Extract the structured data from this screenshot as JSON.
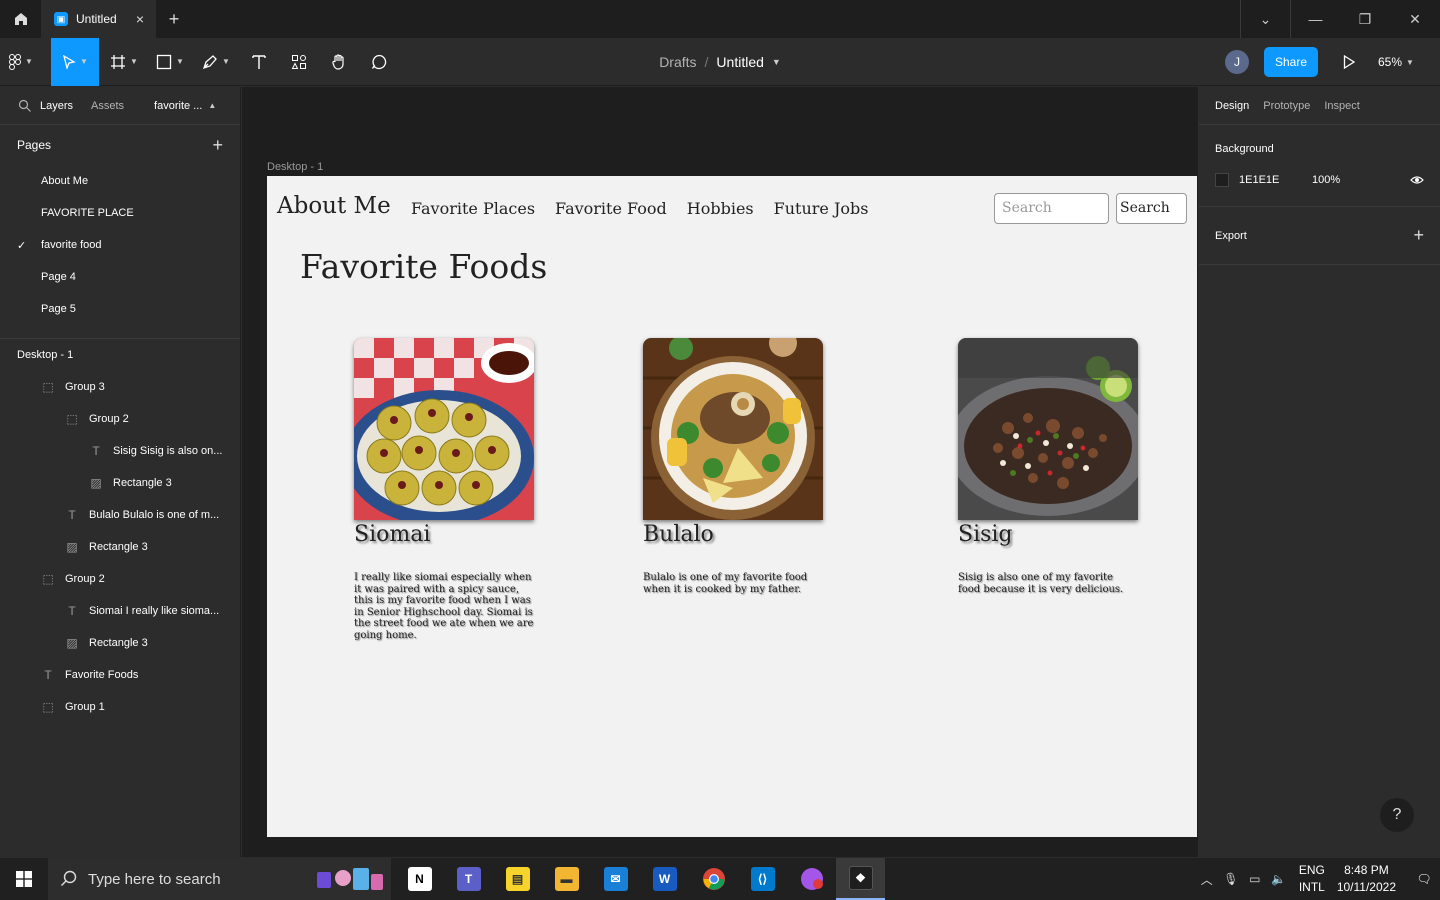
{
  "window": {
    "tab_title": "Untitled",
    "tab_close": "×",
    "new_tab": "+",
    "controls": [
      "chevron-down",
      "minimize",
      "restore",
      "close"
    ]
  },
  "toolbar": {
    "breadcrumb_root": "Drafts",
    "breadcrumb_separator": "/",
    "file_name": "Untitled",
    "avatar_initial": "J",
    "share_label": "Share",
    "zoom": "65%"
  },
  "left_panel": {
    "tabs": [
      "Layers",
      "Assets"
    ],
    "current_page_short": "favorite ...",
    "pages_header": "Pages",
    "pages": [
      {
        "label": "About Me",
        "selected": false
      },
      {
        "label": "FAVORITE PLACE",
        "selected": false
      },
      {
        "label": "favorite food",
        "selected": true
      },
      {
        "label": "Page 4",
        "selected": false
      },
      {
        "label": "Page 5",
        "selected": false
      }
    ],
    "layers": [
      {
        "label": "Desktop - 1",
        "type": "frame",
        "depth": 0
      },
      {
        "label": "Group 3",
        "type": "group",
        "depth": 1
      },
      {
        "label": "Group 2",
        "type": "group",
        "depth": 2
      },
      {
        "label": "Sisig Sisig is also on...",
        "type": "text",
        "depth": 3
      },
      {
        "label": "Rectangle 3",
        "type": "image",
        "depth": 3
      },
      {
        "label": "Bulalo Bulalo is one of m...",
        "type": "text",
        "depth": 2
      },
      {
        "label": "Rectangle 3",
        "type": "image",
        "depth": 2
      },
      {
        "label": "Group 2",
        "type": "group",
        "depth": 1
      },
      {
        "label": "Siomai I really like sioma...",
        "type": "text",
        "depth": 2
      },
      {
        "label": "Rectangle 3",
        "type": "image",
        "depth": 2
      },
      {
        "label": "Favorite Foods",
        "type": "text",
        "depth": 1
      },
      {
        "label": "Group 1",
        "type": "group",
        "depth": 1
      }
    ]
  },
  "canvas": {
    "frame_label": "Desktop - 1",
    "site": {
      "title": "About Me",
      "nav": [
        "Favorite Places",
        "Favorite Food",
        "Hobbies",
        "Future Jobs"
      ],
      "search_placeholder": "Search",
      "search_button": "Search",
      "heading": "Favorite Foods",
      "cards": [
        {
          "name": "Siomai",
          "description": "I really like siomai especially when it was paired with a spicy sauce, this is my favorite food when I was in Senior Highschool day. Siomai is the street food we ate when we are going home."
        },
        {
          "name": "Bulalo",
          "description": "Bulalo is one of my favorite food when it is cooked by my father."
        },
        {
          "name": "Sisig",
          "description": "Sisig is also one of my favorite food because it is very delicious."
        }
      ]
    }
  },
  "right_panel": {
    "tabs": [
      "Design",
      "Prototype",
      "Inspect"
    ],
    "background_title": "Background",
    "background_hex": "1E1E1E",
    "background_opacity": "100%",
    "export_title": "Export",
    "help": "?"
  },
  "taskbar": {
    "search_placeholder": "Type here to search",
    "lang_line1": "ENG",
    "lang_line2": "INTL",
    "time": "8:48 PM",
    "date": "10/11/2022"
  },
  "colors": {
    "accent": "#0d99ff",
    "panel": "#2c2c2c",
    "canvas": "#1e1e1e",
    "frame": "#f2f2f2"
  }
}
